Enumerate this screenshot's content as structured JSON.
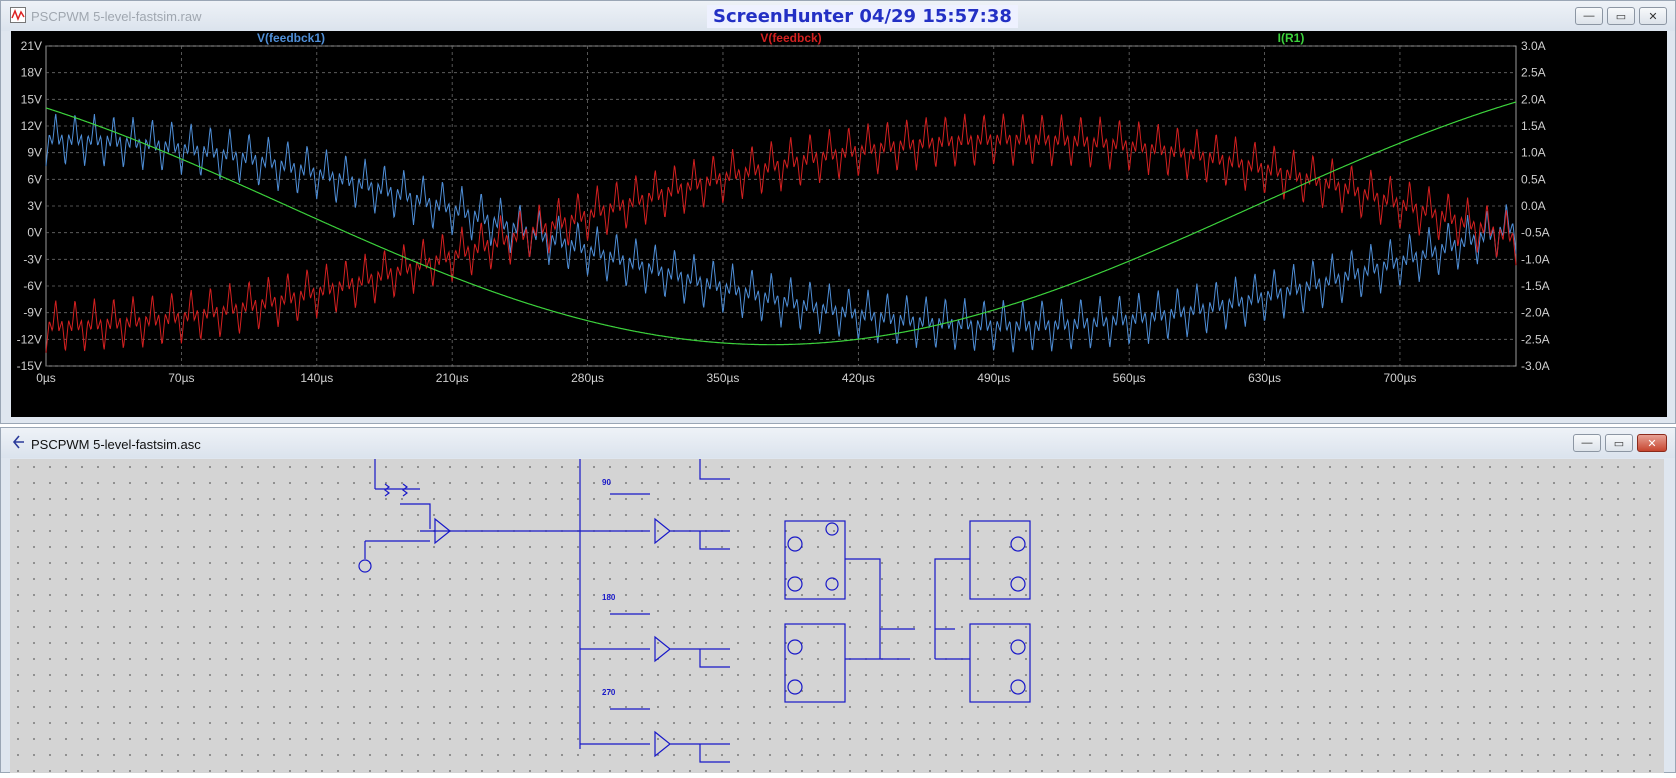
{
  "plot_window": {
    "title": "PSCPWM 5-level-fastsim.raw",
    "screenhunter": "ScreenHunter  04/29  15:57:38"
  },
  "schematic_window": {
    "title": "PSCPWM 5-level-fastsim.asc",
    "labels": [
      "90",
      "180",
      "270"
    ]
  },
  "window_controls": {
    "minimize": "—",
    "maximize": "▭",
    "close": "✕"
  },
  "chart_data": {
    "type": "line",
    "series": [
      {
        "name": "V(feedbck1)",
        "color": "#4f8fd8",
        "axis": "left",
        "offset": 0,
        "amplitude": 10.5,
        "phase_deg": 90,
        "ripple": 3.0
      },
      {
        "name": "V(feedbck)",
        "color": "#d42020",
        "axis": "left",
        "offset": 0,
        "amplitude": -10.5,
        "phase_deg": 90,
        "ripple": 3.0
      },
      {
        "name": "I(R1)",
        "color": "#3cd23c",
        "axis": "right",
        "offset": 0,
        "amplitude": 2.6,
        "phase_deg": 135,
        "ripple": 0
      }
    ],
    "x": {
      "range": [
        0,
        760
      ],
      "unit": "µs",
      "ticks": [
        "0µs",
        "70µs",
        "140µs",
        "210µs",
        "280µs",
        "350µs",
        "420µs",
        "490µs",
        "560µs",
        "630µs",
        "700µs"
      ]
    },
    "y_left": {
      "range": [
        -15,
        21
      ],
      "ticks": [
        "21V",
        "18V",
        "15V",
        "12V",
        "9V",
        "6V",
        "3V",
        "0V",
        "-3V",
        "-6V",
        "-9V",
        "-12V",
        "-15V"
      ]
    },
    "y_right": {
      "range": [
        -3.0,
        3.0
      ],
      "ticks": [
        "3.0A",
        "2.5A",
        "2.0A",
        "1.5A",
        "1.0A",
        "0.5A",
        "0.0A",
        "-0.5A",
        "-1.0A",
        "-1.5A",
        "-2.0A",
        "-2.5A",
        "-3.0A"
      ]
    },
    "period_us": 1000,
    "ripple_period_us": 10,
    "grid": true
  }
}
